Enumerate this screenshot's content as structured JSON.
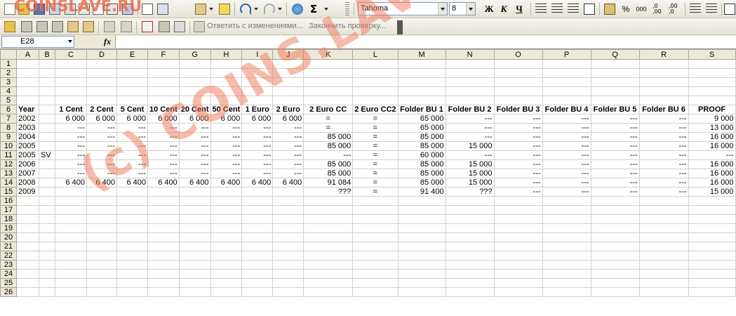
{
  "toolbar": {
    "font_name": "Tahoma",
    "font_size": "8",
    "bold_label": "Ж",
    "italic_label": "К",
    "underline_label": "Ч",
    "percent_label": "%",
    "thousands_label": "000",
    "sum_label": "Σ",
    "reply_with_changes": "Ответить с изменениями...",
    "end_review": "Закончить проверку..."
  },
  "formula_bar": {
    "name_box": "E28",
    "fx_label": "fx",
    "formula": ""
  },
  "sheet": {
    "columns": [
      "A",
      "B",
      "C",
      "D",
      "E",
      "F",
      "G",
      "H",
      "I",
      "J",
      "K",
      "L",
      "M",
      "N",
      "O",
      "P",
      "Q",
      "R",
      "S"
    ],
    "row_numbers": [
      "1",
      "2",
      "3",
      "4",
      "5",
      "6",
      "7",
      "8",
      "9",
      "10",
      "11",
      "12",
      "13",
      "14",
      "15",
      "16",
      "17",
      "18",
      "19",
      "20",
      "21",
      "22",
      "23",
      "24",
      "25",
      "26"
    ],
    "header_row": [
      "Year",
      "",
      "1 Cent",
      "2 Cent",
      "5 Cent",
      "10 Cent",
      "20 Cent",
      "50 Cent",
      "1 Euro",
      "2 Euro",
      "2 Euro CC",
      "2 Euro CC2",
      "Folder BU 1",
      "Folder BU 2",
      "Folder BU 3",
      "Folder BU 4",
      "Folder BU 5",
      "Folder BU 6",
      "PROOF"
    ],
    "data_rows": [
      [
        "2002",
        "",
        "6 000",
        "6 000",
        "6 000",
        "6 000",
        "6 000",
        "6 000",
        "6 000",
        "6 000",
        "=",
        "=",
        "65 000",
        "---",
        "---",
        "---",
        "---",
        "---",
        "9 000"
      ],
      [
        "2003",
        "",
        "---",
        "---",
        "---",
        "---",
        "---",
        "---",
        "---",
        "---",
        "=",
        "=",
        "65 000",
        "---",
        "---",
        "---",
        "---",
        "---",
        "13 000"
      ],
      [
        "2004",
        "",
        "---",
        "---",
        "---",
        "---",
        "---",
        "---",
        "---",
        "---",
        "85 000",
        "=",
        "85 000",
        "---",
        "---",
        "---",
        "---",
        "---",
        "16 000"
      ],
      [
        "2005",
        "",
        "---",
        "---",
        "---",
        "---",
        "---",
        "---",
        "---",
        "---",
        "85 000",
        "=",
        "85 000",
        "15 000",
        "---",
        "---",
        "---",
        "---",
        "16 000"
      ],
      [
        "2005",
        "SV",
        "---",
        "---",
        "---",
        "---",
        "---",
        "---",
        "---",
        "---",
        "---",
        "=",
        "60 000",
        "---",
        "---",
        "---",
        "---",
        "---",
        "---"
      ],
      [
        "2006",
        "",
        "---",
        "---",
        "---",
        "---",
        "---",
        "---",
        "---",
        "---",
        "85 000",
        "=",
        "85 000",
        "15 000",
        "---",
        "---",
        "---",
        "---",
        "16 000"
      ],
      [
        "2007",
        "",
        "---",
        "---",
        "---",
        "---",
        "---",
        "---",
        "---",
        "---",
        "85 000",
        "=",
        "85 000",
        "15 000",
        "---",
        "---",
        "---",
        "---",
        "16 000"
      ],
      [
        "2008",
        "",
        "6 400",
        "6 400",
        "6 400",
        "6 400",
        "6 400",
        "6 400",
        "6 400",
        "6 400",
        "91 084",
        "=",
        "85 000",
        "15 000",
        "---",
        "---",
        "---",
        "---",
        "16 000"
      ],
      [
        "2009",
        "",
        "",
        "",
        "",
        "",
        "",
        "",
        "",
        "",
        "???",
        "=",
        "91 400",
        "???",
        "---",
        "---",
        "---",
        "---",
        "15 000"
      ]
    ]
  },
  "watermark": {
    "top": "COINSLAVE.RU",
    "diagonal": "(c) COINS.LAVE.RU"
  }
}
